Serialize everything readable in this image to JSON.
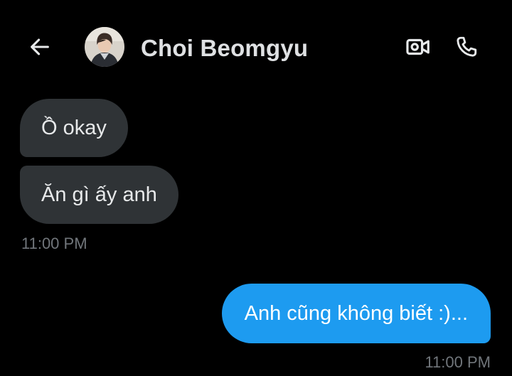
{
  "header": {
    "contact_name": "Choi Beomgyu",
    "back_icon": "back-arrow-icon",
    "video_icon": "video-camera-icon",
    "call_icon": "phone-icon"
  },
  "messages": [
    {
      "direction": "received",
      "text": "Ồ okay"
    },
    {
      "direction": "received",
      "text": "Ăn gì ấy anh"
    },
    {
      "direction": "sent",
      "text": "Anh cũng không biết :)..."
    }
  ],
  "timestamps": {
    "received_group": "11:00 PM",
    "sent_group": "11:00 PM"
  },
  "colors": {
    "background": "#000000",
    "received_bubble": "#2f3336",
    "sent_bubble": "#1d9bf0",
    "timestamp": "#71767b",
    "text": "#e7e9ea"
  }
}
